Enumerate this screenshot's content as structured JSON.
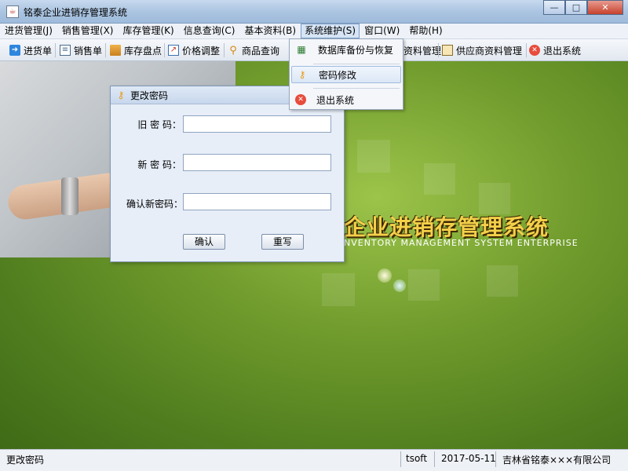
{
  "window": {
    "title": "铭泰企业进销存管理系统",
    "minimize_glyph": "—",
    "maximize_glyph": "□",
    "close_glyph": "✕"
  },
  "menubar": [
    {
      "label": "进货管理(J)"
    },
    {
      "label": "销售管理(X)"
    },
    {
      "label": "库存管理(K)"
    },
    {
      "label": "信息查询(C)"
    },
    {
      "label": "基本资料(B)"
    },
    {
      "label": "系统维护(S)"
    },
    {
      "label": "窗口(W)"
    },
    {
      "label": "帮助(H)"
    }
  ],
  "toolbar": [
    {
      "label": "进货单",
      "icon": "arrow-in-icon"
    },
    {
      "label": "销售单",
      "icon": "document-icon"
    },
    {
      "label": "库存盘点",
      "icon": "inventory-icon"
    },
    {
      "label": "价格调整",
      "icon": "chart-icon"
    },
    {
      "label": "商品查询",
      "icon": "search-user-icon"
    },
    {
      "label": "资料管理",
      "icon": "folder-icon"
    },
    {
      "label": "供应商资料管理",
      "icon": "supplier-icon"
    },
    {
      "label": "退出系统",
      "icon": "exit-icon"
    }
  ],
  "dropdown": [
    {
      "label": "数据库备份与恢复",
      "icon": "database-icon"
    },
    {
      "label": "密码修改",
      "icon": "key-icon"
    },
    {
      "label": "退出系统",
      "icon": "exit-icon"
    }
  ],
  "dialog": {
    "title": "更改密码",
    "old_password_label": "旧 密 码：",
    "new_password_label": "新 密 码：",
    "confirm_password_label": "确认新密码：",
    "old_password_value": "",
    "new_password_value": "",
    "confirm_password_value": "",
    "ok_button": "确认",
    "reset_button": "重写"
  },
  "branding": {
    "title_cn_partial": "企业进销存管理系统",
    "title_en_partial": "NVENTORY MANAGEMENT SYSTEM ENTERPRISE"
  },
  "statusbar": {
    "message": "更改密码",
    "user": "tsoft",
    "date": "2017-05-11",
    "company": "吉林省铭泰×××有限公司"
  },
  "colors": {
    "accent": "#7a9cc8",
    "brand_gold": "#f4d04a",
    "desktop_green": "#6f9a2c"
  }
}
